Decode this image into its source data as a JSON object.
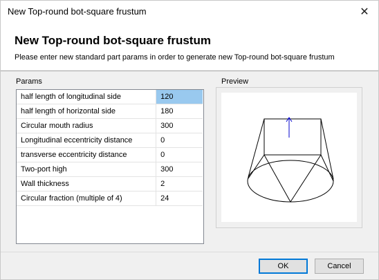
{
  "window": {
    "title": "New Top-round bot-square frustum",
    "close_glyph": "✕"
  },
  "header": {
    "title": "New Top-round bot-square frustum",
    "description": "Please enter new standard part params in order to generate new Top-round bot-square frustum"
  },
  "params": {
    "label": "Params",
    "rows": [
      {
        "name": "half length of longitudinal side",
        "value": "120",
        "selected": true
      },
      {
        "name": "half length of horizontal side",
        "value": "180"
      },
      {
        "name": "Circular mouth radius",
        "value": "300"
      },
      {
        "name": "Longitudinal eccentricity distance",
        "value": "0"
      },
      {
        "name": "transverse eccentricity distance",
        "value": "0"
      },
      {
        "name": "Two-port high",
        "value": "300"
      },
      {
        "name": "Wall thickness",
        "value": "2"
      },
      {
        "name": "Circular fraction (multiple of 4)",
        "value": "24"
      }
    ]
  },
  "preview": {
    "label": "Preview",
    "arrow_color": "#0000cc"
  },
  "buttons": {
    "ok": "OK",
    "cancel": "Cancel"
  }
}
